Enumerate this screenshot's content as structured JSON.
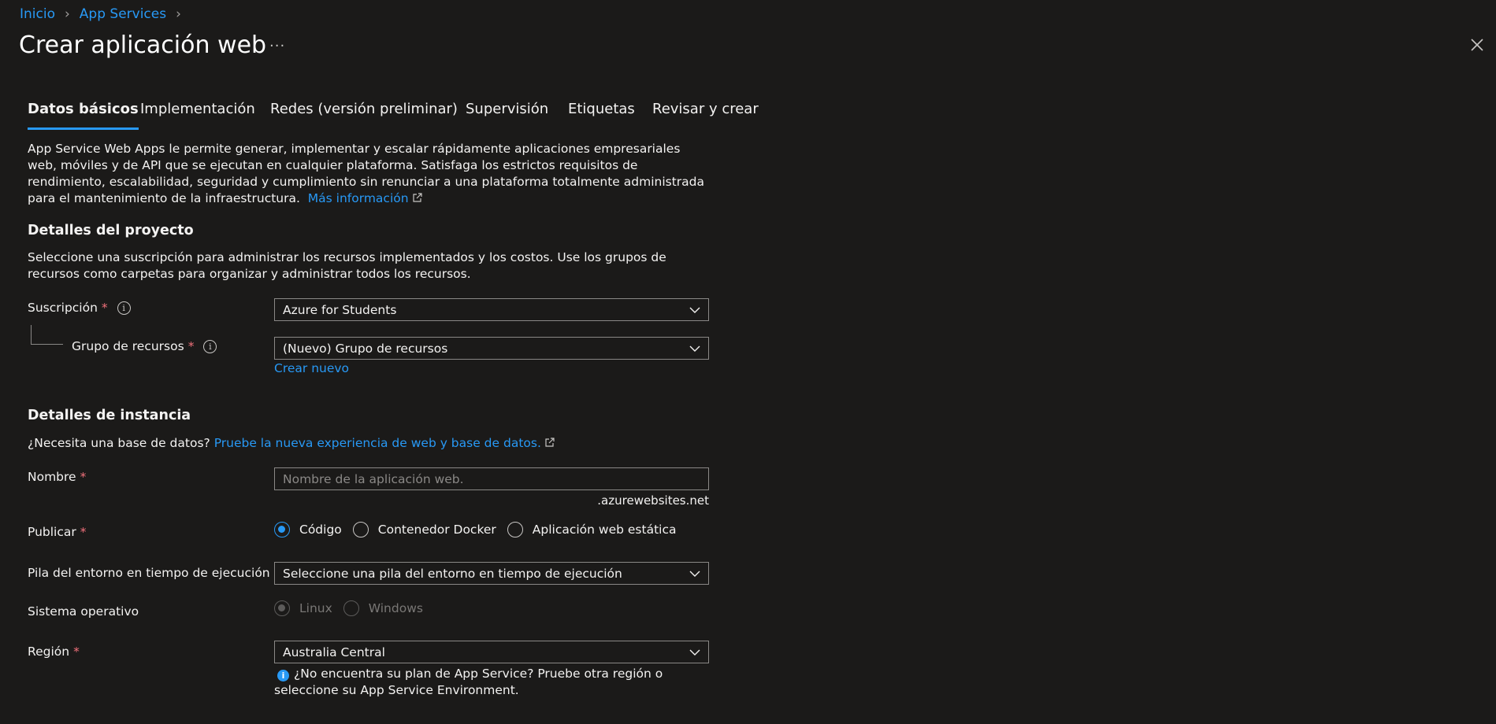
{
  "breadcrumb": {
    "home": "Inicio",
    "parent": "App Services"
  },
  "title": "Crear aplicación web",
  "more_label": "···",
  "tabs": [
    {
      "label": "Datos básicos"
    },
    {
      "label": "Implementación"
    },
    {
      "label": "Redes (versión preliminar)"
    },
    {
      "label": "Supervisión"
    },
    {
      "label": "Etiquetas"
    },
    {
      "label": "Revisar y crear"
    }
  ],
  "intro": {
    "text": "App Service Web Apps le permite generar, implementar y escalar rápidamente aplicaciones empresariales web, móviles y de API que se ejecutan en cualquier plataforma. Satisfaga los estrictos requisitos de rendimiento, escalabilidad, seguridad y cumplimiento sin renunciar a una plataforma totalmente administrada para el mantenimiento de la infraestructura.",
    "link": "Más información"
  },
  "project": {
    "heading": "Detalles del proyecto",
    "description": "Seleccione una suscripción para administrar los recursos implementados y los costos. Use los grupos de recursos como carpetas para organizar y administrar todos los recursos.",
    "subscription_label": "Suscripción",
    "subscription_value": "Azure for Students",
    "resource_group_label": "Grupo de recursos",
    "resource_group_value": "(Nuevo) Grupo de recursos",
    "create_new": "Crear nuevo"
  },
  "instance": {
    "heading": "Detalles de instancia",
    "db_prompt": "¿Necesita una base de datos?",
    "db_link": "Pruebe la nueva experiencia de web y base de datos.",
    "name_label": "Nombre",
    "name_placeholder": "Nombre de la aplicación web.",
    "name_suffix": ".azurewebsites.net",
    "publish_label": "Publicar",
    "publish_options": [
      "Código",
      "Contenedor Docker",
      "Aplicación web estática"
    ],
    "runtime_label": "Pila del entorno en tiempo de ejecución",
    "runtime_value": "Seleccione una pila del entorno en tiempo de ejecución",
    "os_label": "Sistema operativo",
    "os_options": [
      "Linux",
      "Windows"
    ],
    "region_label": "Región",
    "region_value": "Australia Central",
    "region_note": "¿No encuentra su plan de App Service? Pruebe otra región o seleccione su App Service Environment."
  },
  "required_mark": "*",
  "info_glyph": "i",
  "colors": {
    "accent": "#2899f5",
    "required": "#f1707b",
    "background": "#1b1a19"
  }
}
